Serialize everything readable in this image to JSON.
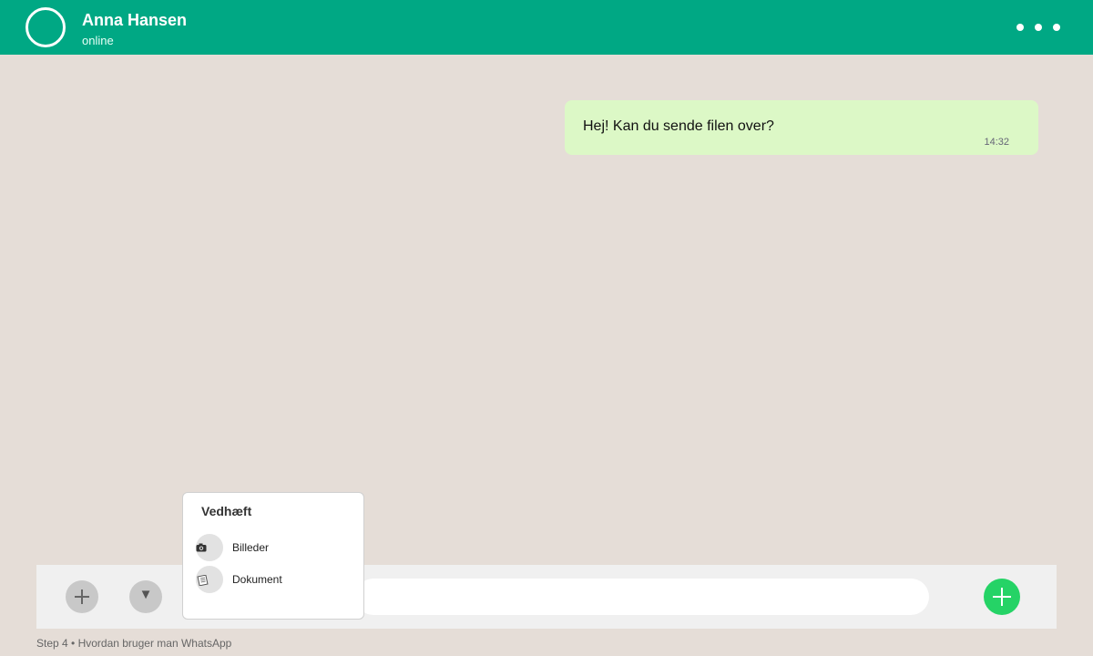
{
  "header": {
    "contact_name": "Anna Hansen",
    "status": "online",
    "menu_icon": "more-horizontal-icon",
    "background_color": "#00a884"
  },
  "messages": [
    {
      "text": "Hej! Kan du sende filen over?",
      "time": "14:32",
      "direction": "outgoing",
      "bubble_color": "#dcf8c6"
    }
  ],
  "attach_menu": {
    "title": "Vedhæft",
    "items": [
      {
        "label": "Billeder",
        "icon": "camera-icon"
      },
      {
        "label": "Dokument",
        "icon": "document-icon"
      }
    ]
  },
  "input_bar": {
    "message_value": "",
    "add_icon": "plus-icon",
    "expand_icon": "chevron-down-icon",
    "send_icon": "plus-icon",
    "send_color": "#25d366"
  },
  "caption": "Step 4 • Hvordan bruger man WhatsApp"
}
